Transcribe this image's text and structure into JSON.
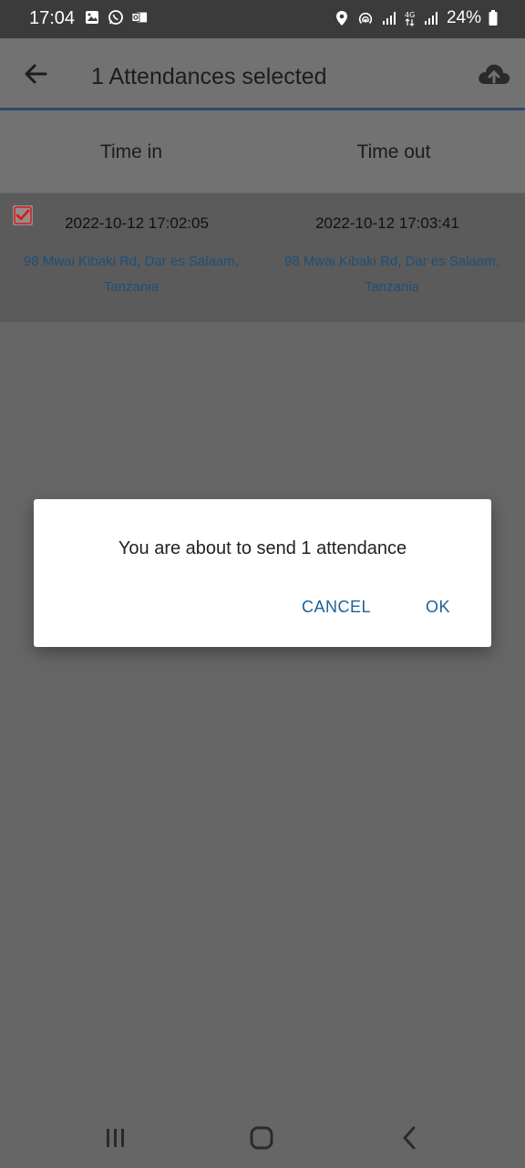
{
  "status_bar": {
    "time": "17:04",
    "battery": "24%",
    "left_icons": [
      "image-icon",
      "whatsapp-icon",
      "outlook-icon"
    ],
    "right_icons": [
      "location-icon",
      "hotspot-icon",
      "signal-icon",
      "4g-signal-icon",
      "signal-icon-2",
      "battery-icon"
    ],
    "network_label": "4G"
  },
  "app_bar": {
    "title": "1 Attendances selected",
    "back_icon": "arrow-left-icon",
    "upload_icon": "cloud-upload-icon"
  },
  "table": {
    "headers": [
      "Time in",
      "Time out"
    ],
    "rows": [
      {
        "checked": true,
        "time_in": "2022-10-12 17:02:05",
        "time_out": "2022-10-12 17:03:41",
        "location_in": "98 Mwai Kibaki Rd, Dar es Salaam, Tanzania",
        "location_out": "98 Mwai Kibaki Rd, Dar es Salaam, Tanzania"
      }
    ]
  },
  "dialog": {
    "message": "You are about to send 1 attendance",
    "cancel_label": "CANCEL",
    "ok_label": "OK"
  },
  "nav_bar": {
    "icons": [
      "recents-icon",
      "home-icon",
      "back-icon"
    ]
  },
  "colors": {
    "accent": "#1d6198",
    "scrim": "#666666",
    "check_red": "#cc1f1f"
  }
}
